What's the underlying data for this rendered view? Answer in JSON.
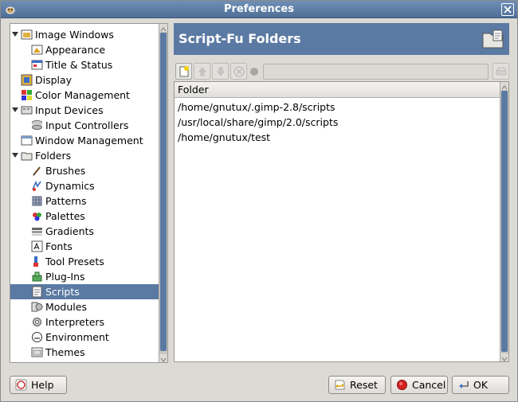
{
  "window": {
    "title": "Preferences"
  },
  "tree": {
    "items": [
      {
        "label": "Image Windows",
        "level": 0,
        "expanded": true,
        "icon": "image-windows-icon"
      },
      {
        "label": "Appearance",
        "level": 1,
        "icon": "appearance-icon"
      },
      {
        "label": "Title & Status",
        "level": 1,
        "icon": "title-status-icon"
      },
      {
        "label": "Display",
        "level": 0,
        "icon": "display-icon"
      },
      {
        "label": "Color Management",
        "level": 0,
        "icon": "color-management-icon"
      },
      {
        "label": "Input Devices",
        "level": 0,
        "expanded": true,
        "icon": "input-devices-icon"
      },
      {
        "label": "Input Controllers",
        "level": 1,
        "icon": "input-controllers-icon"
      },
      {
        "label": "Window Management",
        "level": 0,
        "icon": "window-management-icon"
      },
      {
        "label": "Folders",
        "level": 0,
        "expanded": true,
        "icon": "folders-icon"
      },
      {
        "label": "Brushes",
        "level": 1,
        "icon": "brushes-icon"
      },
      {
        "label": "Dynamics",
        "level": 1,
        "icon": "dynamics-icon"
      },
      {
        "label": "Patterns",
        "level": 1,
        "icon": "patterns-icon"
      },
      {
        "label": "Palettes",
        "level": 1,
        "icon": "palettes-icon"
      },
      {
        "label": "Gradients",
        "level": 1,
        "icon": "gradients-icon"
      },
      {
        "label": "Fonts",
        "level": 1,
        "icon": "fonts-icon"
      },
      {
        "label": "Tool Presets",
        "level": 1,
        "icon": "tool-presets-icon"
      },
      {
        "label": "Plug-Ins",
        "level": 1,
        "icon": "plug-ins-icon"
      },
      {
        "label": "Scripts",
        "level": 1,
        "selected": true,
        "icon": "scripts-icon"
      },
      {
        "label": "Modules",
        "level": 1,
        "icon": "modules-icon"
      },
      {
        "label": "Interpreters",
        "level": 1,
        "icon": "interpreters-icon"
      },
      {
        "label": "Environment",
        "level": 1,
        "icon": "environment-icon"
      },
      {
        "label": "Themes",
        "level": 1,
        "icon": "themes-icon"
      }
    ]
  },
  "panel": {
    "title": "Script-Fu Folders",
    "column_header": "Folder",
    "folders": [
      "/home/gnutux/.gimp-2.8/scripts",
      "/usr/local/share/gimp/2.0/scripts",
      "/home/gnutux/test"
    ],
    "path_value": ""
  },
  "buttons": {
    "help": "Help",
    "reset": "Reset",
    "cancel": "Cancel",
    "ok": "OK"
  },
  "colors": {
    "accent": "#5b7aa3",
    "titlebar": "#5f7fa8",
    "background": "#dcdad5"
  }
}
